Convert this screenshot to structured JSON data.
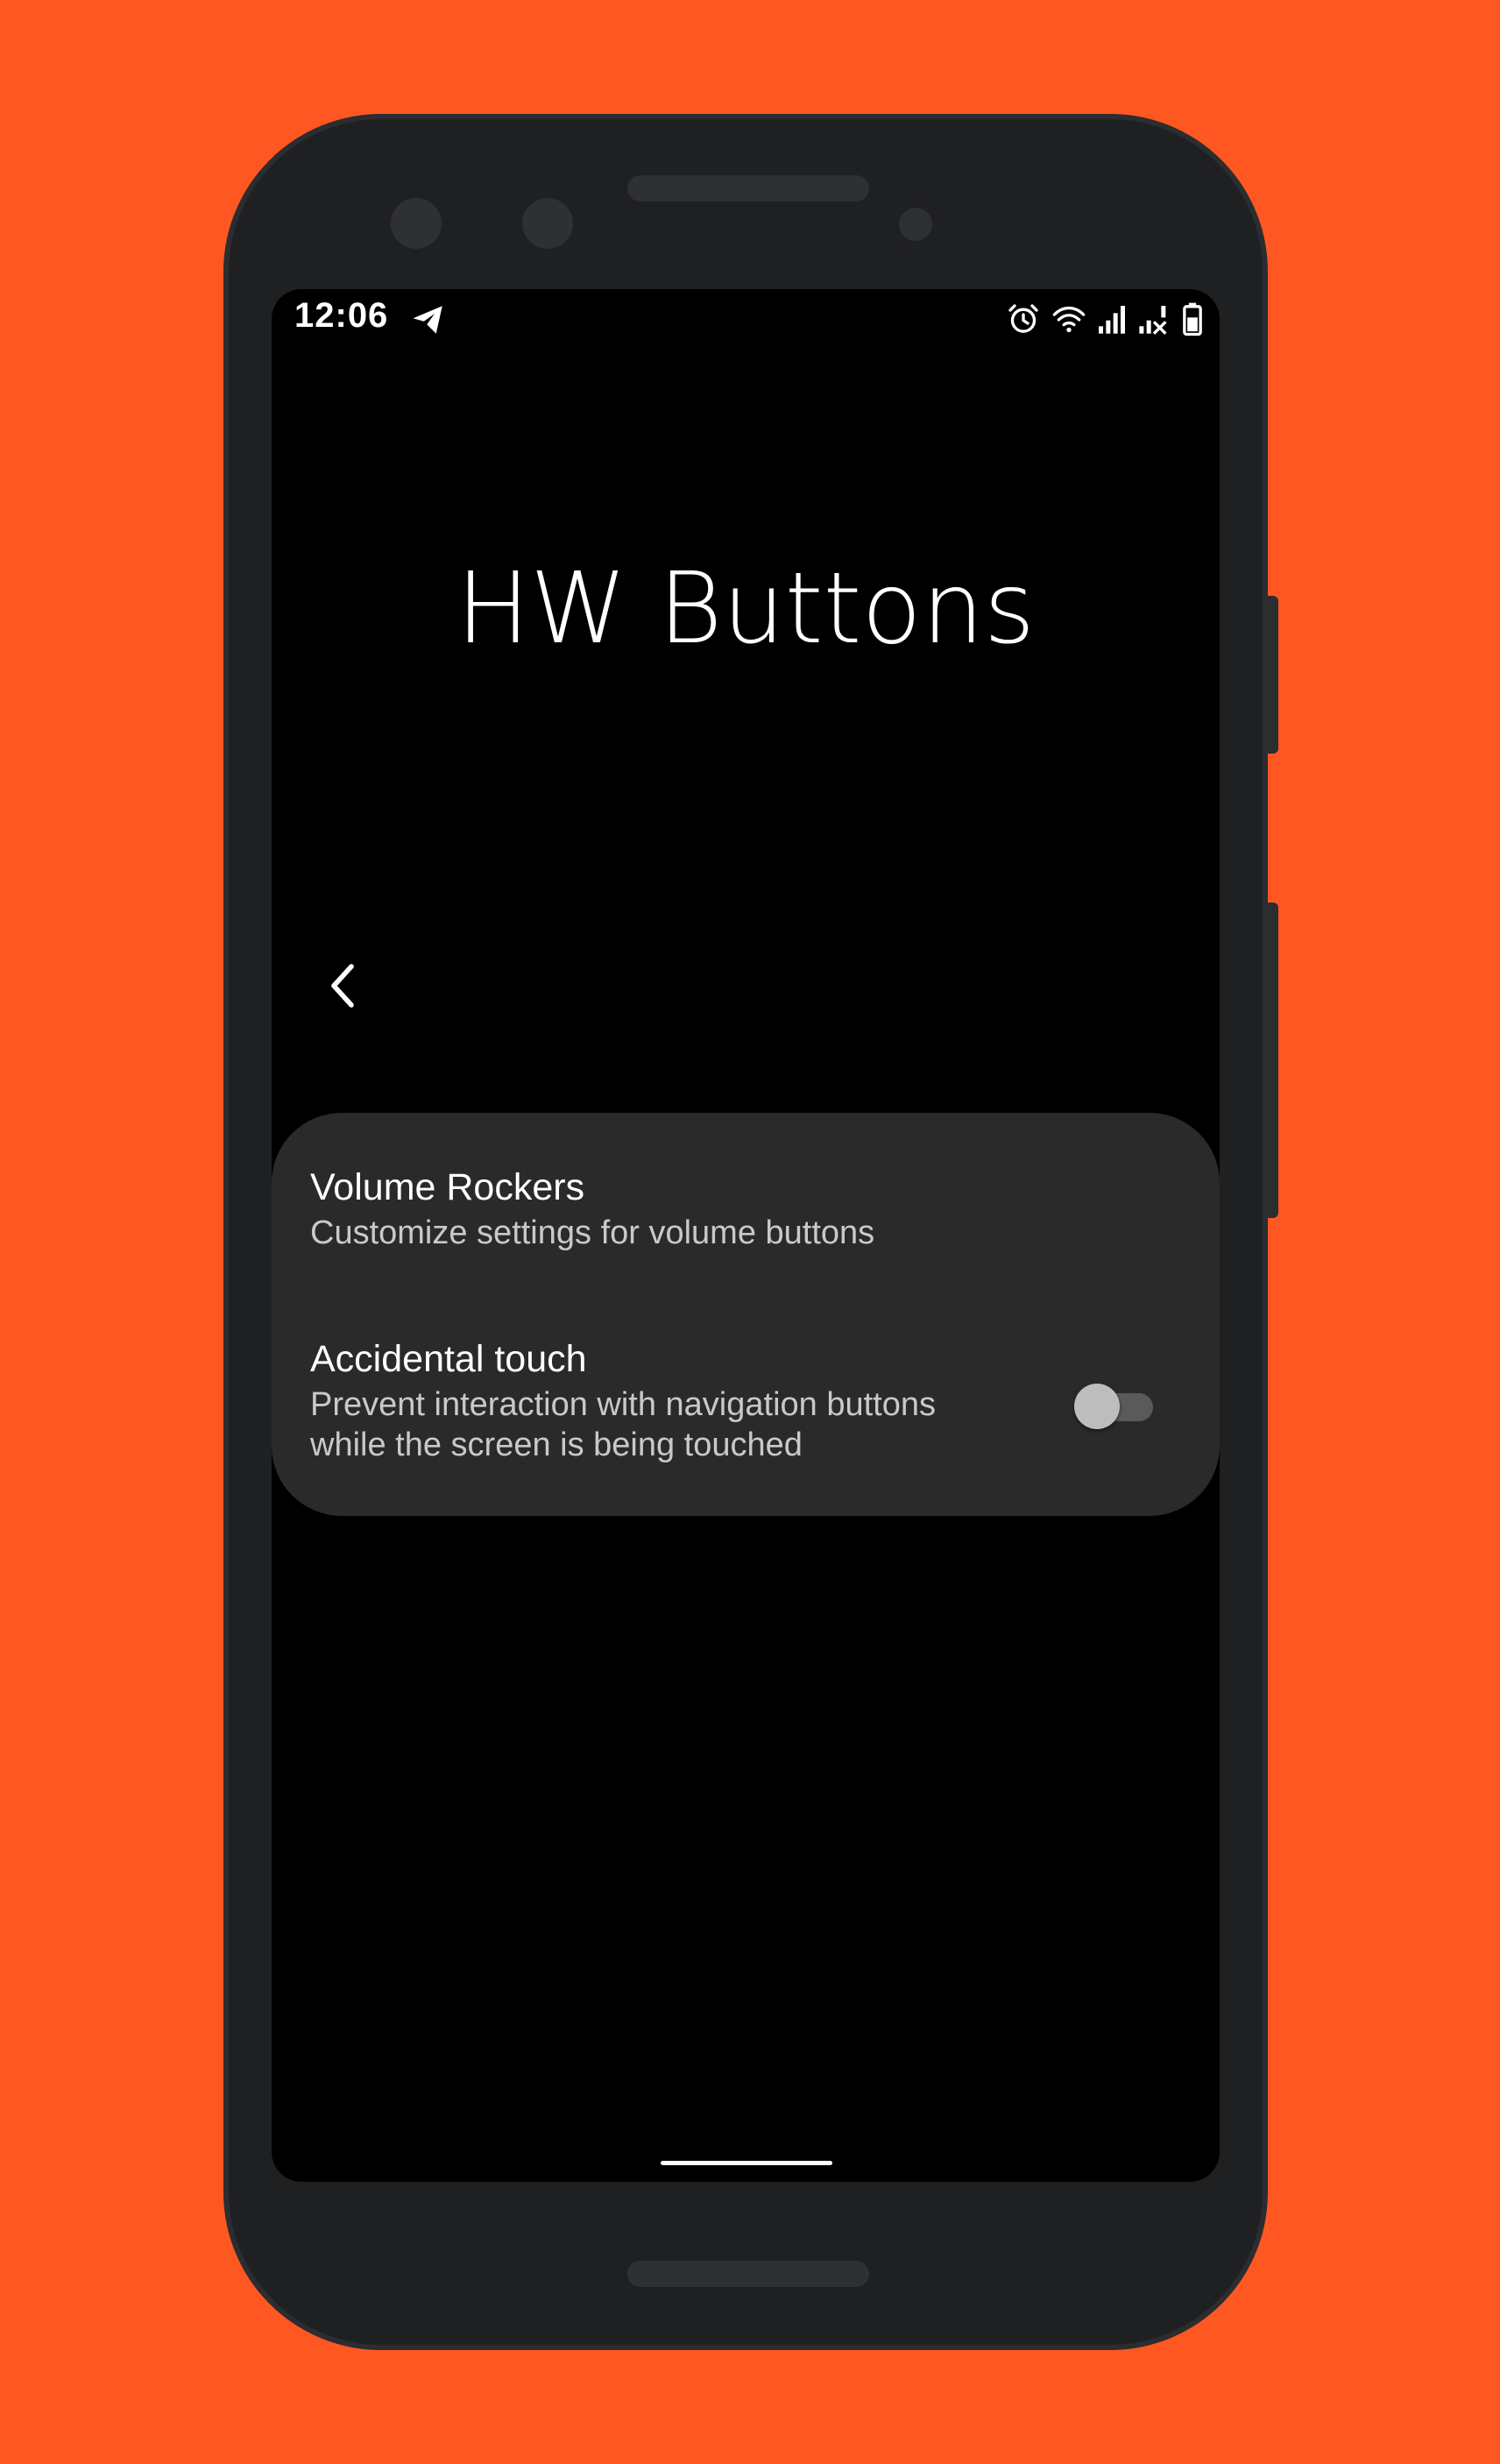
{
  "status_bar": {
    "time": "12:06",
    "icons": [
      "telegram-icon",
      "alarm-icon",
      "wifi-icon",
      "signal-icon",
      "signal-no-data-icon",
      "battery-icon"
    ]
  },
  "page": {
    "title": "HW Buttons"
  },
  "preferences": [
    {
      "title": "Volume Rockers",
      "summary": "Customize settings for volume buttons"
    },
    {
      "title": "Accidental touch",
      "summary": "Prevent interaction with navigation buttons\nwhile the screen is being touched",
      "toggle_on": false
    }
  ],
  "colors": {
    "background": "#FF5722",
    "phone_body": "#1f2022",
    "screen": "#000000",
    "card": "#2a2a2a",
    "text_primary": "#ffffff",
    "text_secondary": "#c9c9c9"
  }
}
